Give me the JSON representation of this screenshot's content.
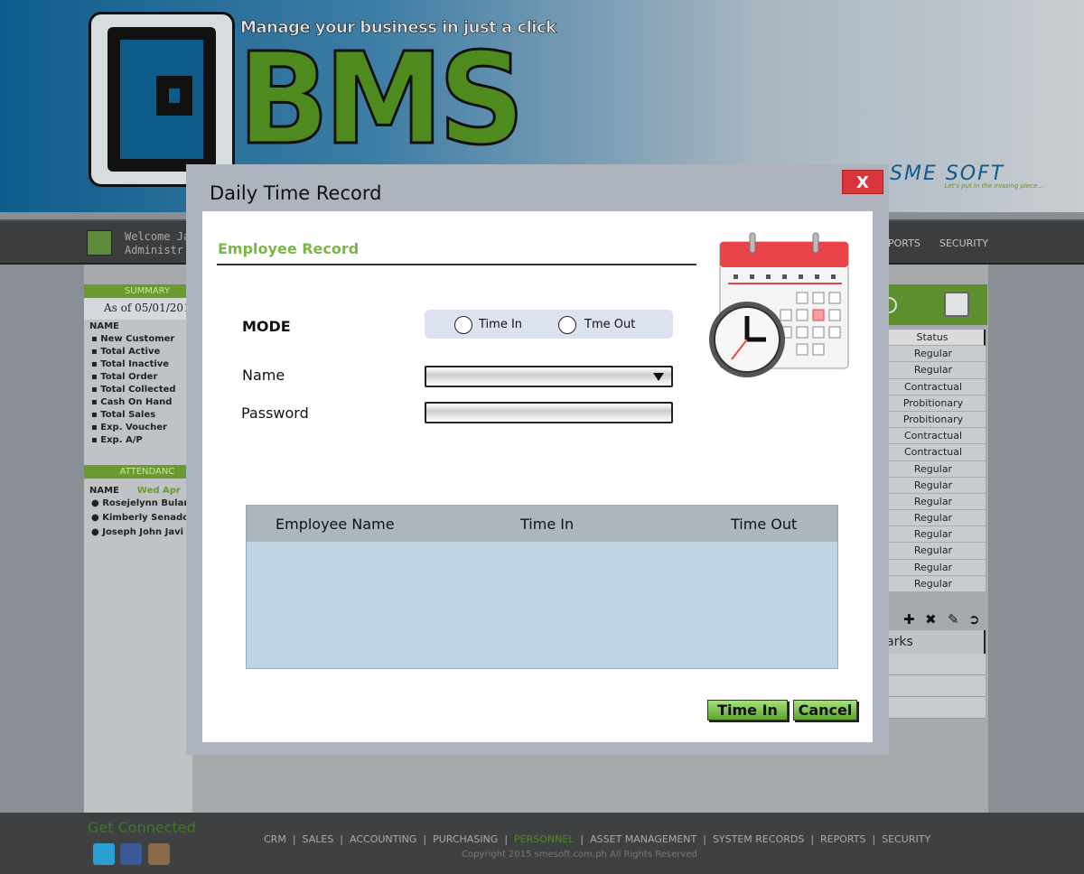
{
  "banner": {
    "tagline": "Manage your business in just a click",
    "logo_text": "BMS",
    "brand_company": "SME SOFT",
    "brand_tagline": "Let's put in the missing piece..."
  },
  "navbar": {
    "welcome_line1": "Welcome Ja",
    "welcome_line2": "Administr",
    "items": [
      "PORTS",
      "SECURITY"
    ]
  },
  "summary": {
    "header": "SUMMARY",
    "as_of": "As of 05/01/201",
    "col_name": "NAME",
    "items": [
      "New Customer",
      "Total Active",
      "Total Inactive",
      "Total Order",
      "Total Collected",
      "Cash On Hand",
      "Total Sales",
      "Exp. Voucher",
      "Exp. A/P"
    ]
  },
  "attendance": {
    "header": "ATTENDANC",
    "col_name": "NAME",
    "date": "Wed Apr",
    "people": [
      "Rosejelynn Bular",
      "Kimberly Senado",
      "Joseph John Javi"
    ]
  },
  "status_list": {
    "header": "Status",
    "rows": [
      "Regular",
      "Regular",
      "Contractual",
      "Probitionary",
      "Probitionary",
      "Contractual",
      "Contractual",
      "Regular",
      "Regular",
      "Regular",
      "Regular",
      "Regular",
      "Regular",
      "Regular",
      "Regular"
    ]
  },
  "remarks": {
    "header": "arks"
  },
  "modal": {
    "title": "Daily Time Record",
    "close_label": "X",
    "section": "Employee Record",
    "mode_label": "MODE",
    "mode_options": [
      "Time In",
      "Tme Out"
    ],
    "name_label": "Name",
    "name_value": "",
    "password_label": "Password",
    "password_value": "",
    "table": {
      "columns": [
        "Employee Name",
        "Time In",
        "Time Out"
      ],
      "rows": []
    },
    "time_in_button": "Time In",
    "cancel_button": "Cancel"
  },
  "footer": {
    "connected": "Get Connected",
    "links": [
      "CRM",
      "SALES",
      "ACCOUNTING",
      "PURCHASING",
      "PERSONNEL",
      "ASSET MANAGEMENT",
      "SYSTEM RECORDS",
      "REPORTS",
      "SECURITY"
    ],
    "active_link": "PERSONNEL",
    "copyright": "Copyright 2015  smesoft.com.ph  All Rights Reserved"
  },
  "colors": {
    "accent_green": "#7ab648",
    "close_red": "#d9363b",
    "modal_bg": "#aeb4bd",
    "table_body": "#bdd4e3"
  }
}
